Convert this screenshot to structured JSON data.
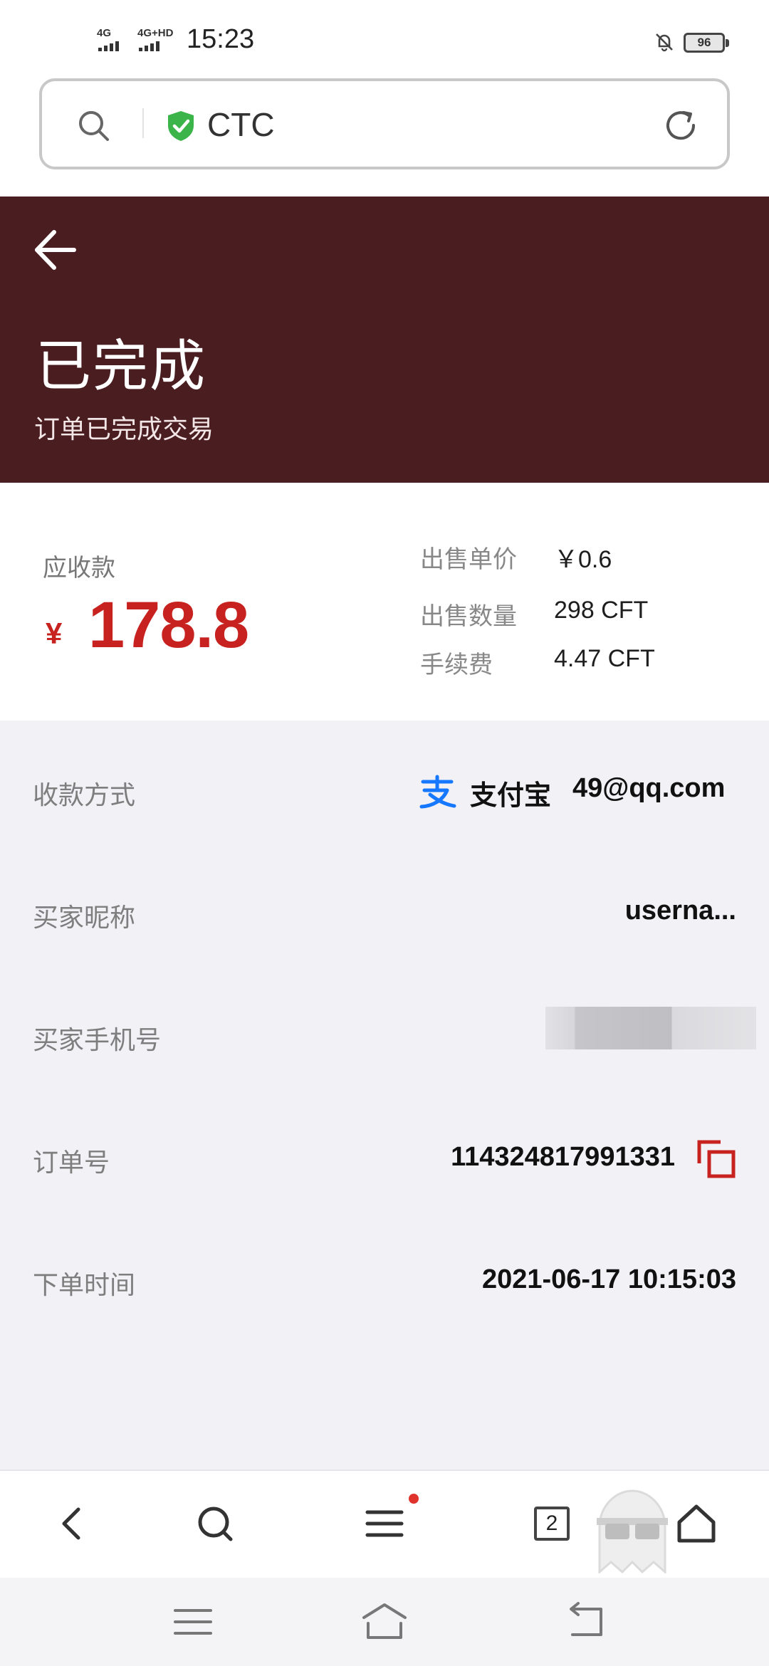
{
  "status_bar": {
    "signal1": "4G",
    "signal2": "4G+HD",
    "time": "15:23",
    "battery": "96"
  },
  "address_bar": {
    "site": "CTC"
  },
  "header": {
    "title": "已完成",
    "subtitle": "订单已完成交易"
  },
  "summary": {
    "due_label": "应收款",
    "currency": "¥",
    "due_amount": "178.8",
    "unit_price_label": "出售单价",
    "unit_price": "￥0.6",
    "quantity_label": "出售数量",
    "quantity": "298 CFT",
    "fee_label": "手续费",
    "fee": "4.47 CFT"
  },
  "details": {
    "payment_method_label": "收款方式",
    "payment_method_name": "支付宝",
    "payment_account": "49@qq.com",
    "buyer_nickname_label": "买家昵称",
    "buyer_nickname": "userna...",
    "buyer_phone_label": "买家手机号",
    "order_number_label": "订单号",
    "order_number": "114324817991331",
    "order_time_label": "下单时间",
    "order_time": "2021-06-17 10:15:03"
  },
  "toolbar": {
    "tab_count": "2"
  },
  "colors": {
    "header_bg": "#4a1d21",
    "amount_red": "#c7221f",
    "shield_green": "#3bb54a",
    "alipay_blue": "#1677ff"
  }
}
